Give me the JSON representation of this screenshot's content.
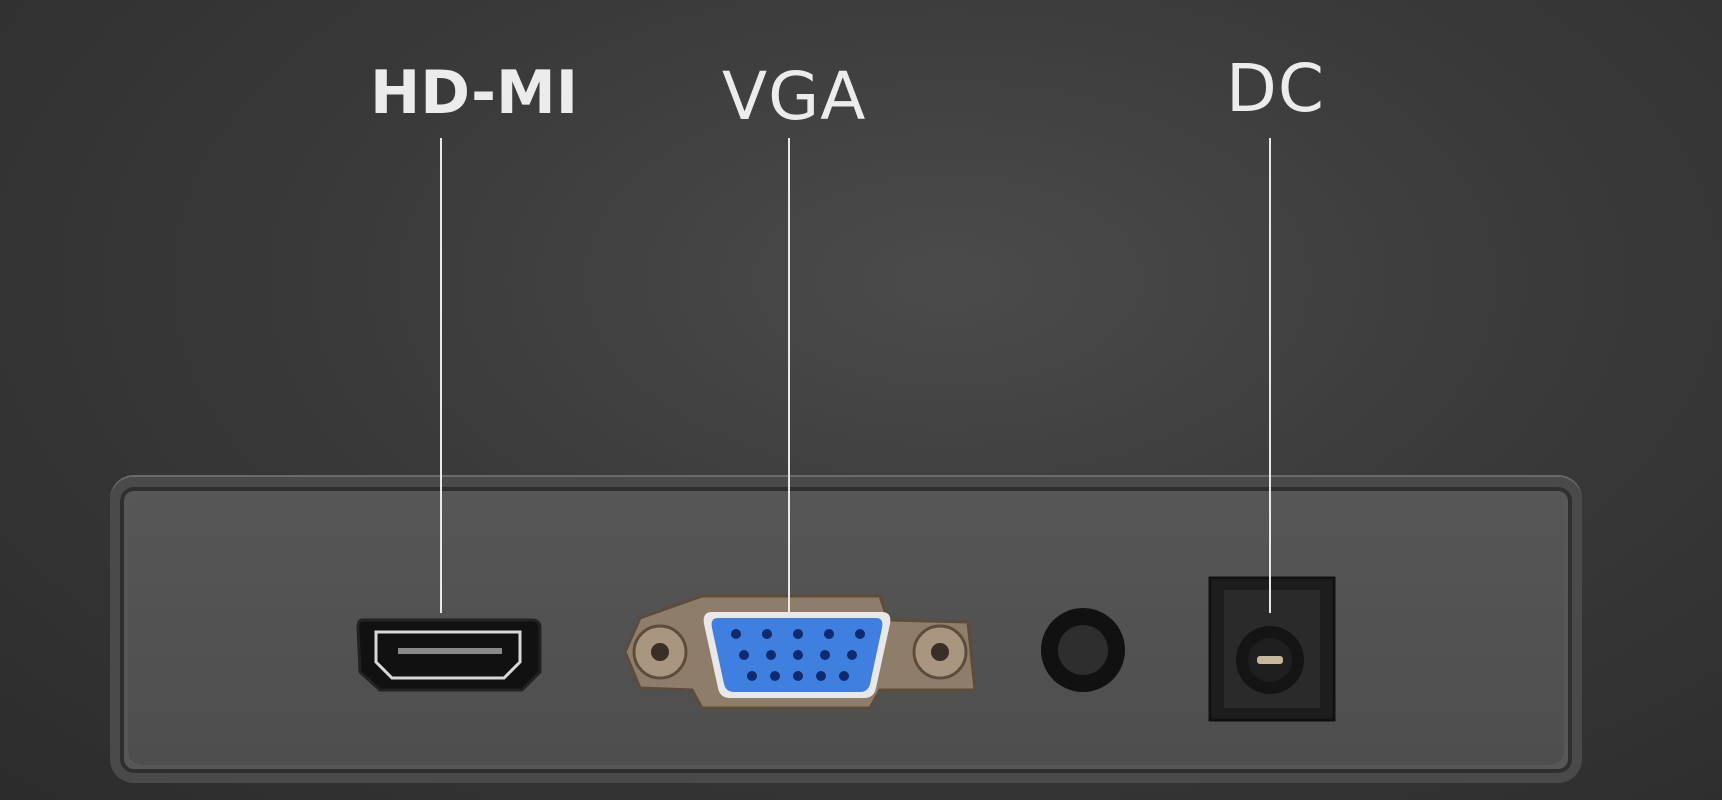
{
  "ports": [
    {
      "id": "hdmi",
      "label": "HD-MI"
    },
    {
      "id": "vga",
      "label": "VGA"
    },
    {
      "id": "dc",
      "label": "DC"
    }
  ],
  "colors": {
    "background": "#333333",
    "panel": "#555555",
    "vga_connector": "#3f7fe0",
    "label_text": "#ececec"
  }
}
